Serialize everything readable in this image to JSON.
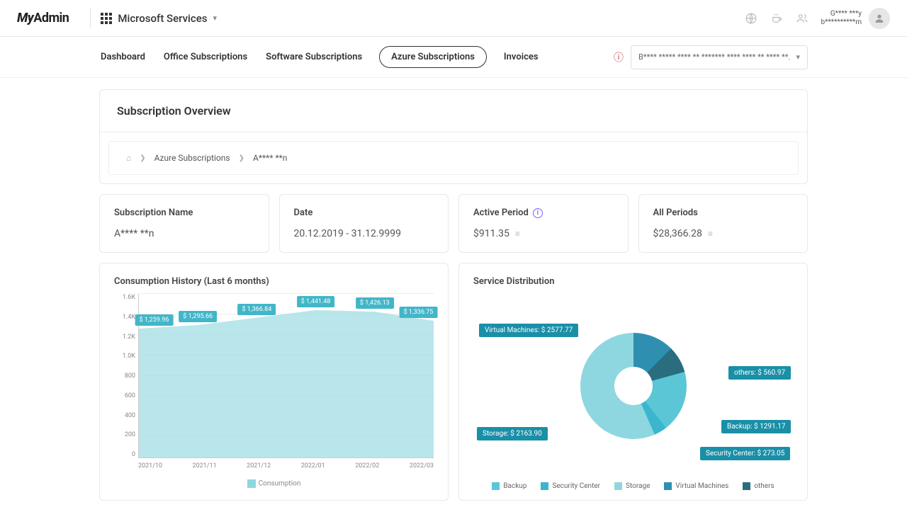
{
  "brand": "MyAdmin",
  "service_selector": "Microsoft Services",
  "user": {
    "name": "G**** ***y",
    "org": "b**********m"
  },
  "tabs": [
    "Dashboard",
    "Office Subscriptions",
    "Software Subscriptions",
    "Azure Subscriptions",
    "Invoices"
  ],
  "active_tab": 3,
  "filter_select": "B**** ***** **** ** ******* **** **** ** **** **.",
  "page_title": "Subscription Overview",
  "breadcrumb": {
    "l1": "Azure Subscriptions",
    "l2": "A**** **n"
  },
  "info": {
    "sub_name_label": "Subscription Name",
    "sub_name_val": "A**** **n",
    "date_label": "Date",
    "date_val": "20.12.2019 - 31.12.9999",
    "active_label": "Active Period",
    "active_val": "$911.35",
    "all_label": "All Periods",
    "all_val": "$28,366.28"
  },
  "chart1_title": "Consumption History (Last 6 months)",
  "chart1_legend": "Consumption",
  "chart2_title": "Service Distribution",
  "chart_data": [
    {
      "type": "area",
      "title": "Consumption History (Last 6 months)",
      "categories": [
        "2021/10",
        "2021/11",
        "2021/12",
        "2022/01",
        "2022/02",
        "2022/03"
      ],
      "series": [
        {
          "name": "Consumption",
          "values": [
            1259.96,
            1295.66,
            1366.84,
            1441.48,
            1426.13,
            1336.75
          ]
        }
      ],
      "ylim": [
        0,
        1600
      ],
      "ylabel": "",
      "xlabel": "",
      "yticks": [
        0,
        200,
        400,
        600,
        800,
        "1.0K",
        "1.2K",
        "1.4K",
        "1.6K"
      ]
    },
    {
      "type": "pie",
      "title": "Service Distribution",
      "series": [
        {
          "name": "Virtual Machines",
          "value": 2577.77,
          "color": "#2e8fb0"
        },
        {
          "name": "others",
          "value": 560.97,
          "color": "#2a6d7f"
        },
        {
          "name": "Backup",
          "value": 1291.17,
          "color": "#5bc6d6"
        },
        {
          "name": "Security Center",
          "value": 273.05,
          "color": "#3bb6cd"
        },
        {
          "name": "Storage",
          "value": 2163.9,
          "color": "#8fd7e0"
        }
      ],
      "legend_order": [
        "Backup",
        "Security Center",
        "Storage",
        "Virtual Machines",
        "others"
      ]
    }
  ]
}
